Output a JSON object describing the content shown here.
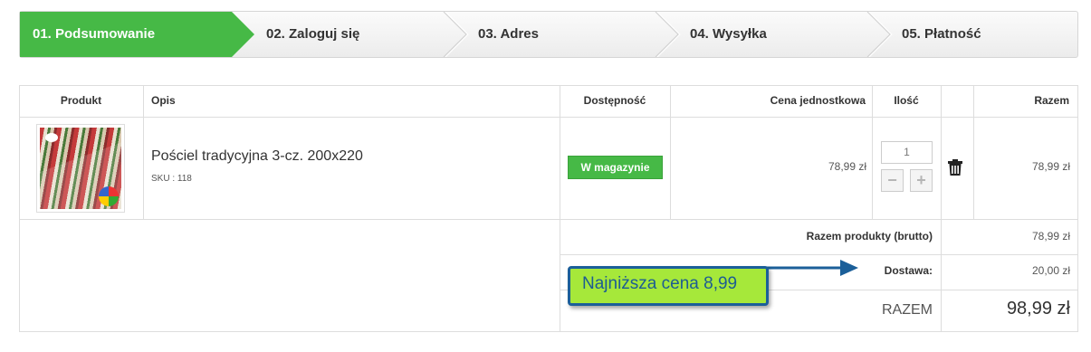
{
  "steps": [
    {
      "label": "01. Podsumowanie",
      "active": true
    },
    {
      "label": "02. Zaloguj się",
      "active": false
    },
    {
      "label": "03. Adres",
      "active": false
    },
    {
      "label": "04. Wysyłka",
      "active": false
    },
    {
      "label": "05. Płatność",
      "active": false
    }
  ],
  "table": {
    "headers": {
      "product": "Produkt",
      "description": "Opis",
      "availability": "Dostępność",
      "unit_price": "Cena jednostkowa",
      "quantity": "Ilość",
      "total": "Razem"
    },
    "row": {
      "name": "Pościel tradycyjna 3-cz. 200x220",
      "sku": "SKU : 118",
      "availability": "W magazynie",
      "unit_price": "78,99 zł",
      "quantity": "1",
      "minus": "−",
      "plus": "+",
      "total": "78,99 zł"
    }
  },
  "summary": {
    "products_label": "Razem produkty (brutto)",
    "products_value": "78,99 zł",
    "shipping_label": "Dostawa:",
    "shipping_value": "20,00 zł",
    "total_label": "RAZEM",
    "total_value": "98,99 zł"
  },
  "annotation": {
    "text": "Najniższa cena 8,99"
  },
  "colors": {
    "active_step": "#46b946",
    "stock_badge": "#46b946",
    "annotation_bg": "#a6e83a",
    "annotation_border": "#1b5f99"
  }
}
